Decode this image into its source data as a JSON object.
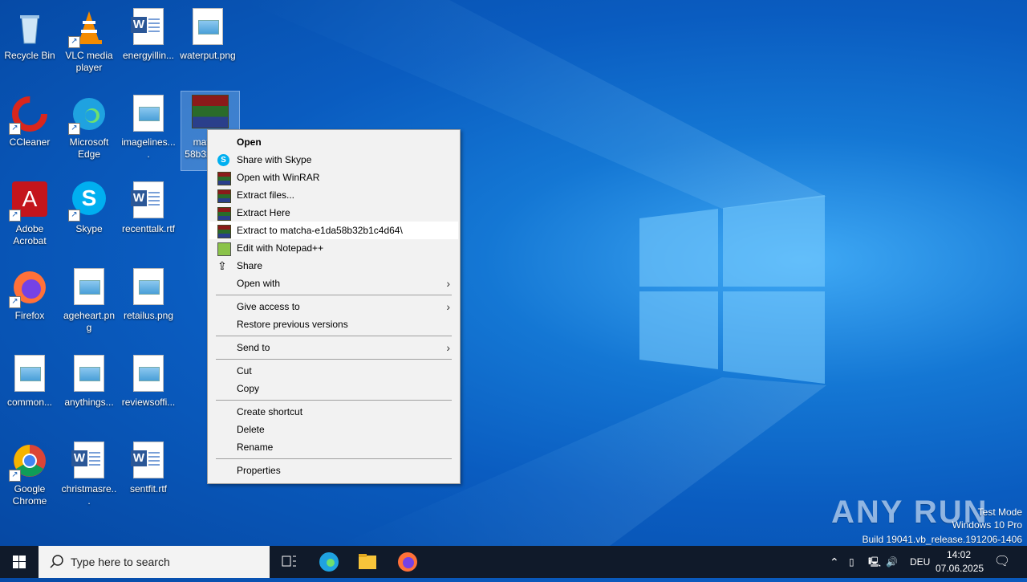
{
  "desktop": {
    "icons": [
      {
        "label": "Recycle Bin"
      },
      {
        "label": "VLC media player"
      },
      {
        "label": "energyillin..."
      },
      {
        "label": "waterput.png"
      },
      {
        "label": "CCleaner"
      },
      {
        "label": "Microsoft Edge"
      },
      {
        "label": "imagelines...."
      },
      {
        "label": "match... 58b32... 4..."
      },
      {
        "label": "Adobe Acrobat"
      },
      {
        "label": "Skype"
      },
      {
        "label": "recenttalk.rtf"
      },
      {
        "label": "Firefox"
      },
      {
        "label": "ageheart.png"
      },
      {
        "label": "retailus.png"
      },
      {
        "label": "common..."
      },
      {
        "label": "anythings..."
      },
      {
        "label": "reviewsoffi..."
      },
      {
        "label": "Google Chrome"
      },
      {
        "label": "christmasre..."
      },
      {
        "label": "sentfit.rtf"
      }
    ]
  },
  "context_menu": {
    "items": [
      {
        "label": "Open"
      },
      {
        "label": "Share with Skype"
      },
      {
        "label": "Open with WinRAR"
      },
      {
        "label": "Extract files..."
      },
      {
        "label": "Extract Here"
      },
      {
        "label": "Extract to matcha-e1da58b32b1c4d64\\"
      },
      {
        "label": "Edit with Notepad++"
      },
      {
        "label": "Share"
      },
      {
        "label": "Open with"
      },
      {
        "label": "Give access to"
      },
      {
        "label": "Restore previous versions"
      },
      {
        "label": "Send to"
      },
      {
        "label": "Cut"
      },
      {
        "label": "Copy"
      },
      {
        "label": "Create shortcut"
      },
      {
        "label": "Delete"
      },
      {
        "label": "Rename"
      },
      {
        "label": "Properties"
      }
    ]
  },
  "taskbar": {
    "search_placeholder": "Type here to search",
    "language": "DEU",
    "time": "14:02",
    "date": "07.06.2025"
  },
  "watermark": {
    "brand": "ANY RUN",
    "line1": "Test Mode",
    "line2": "Windows 10 Pro",
    "line3": "Build 19041.vb_release.191206-1406"
  },
  "colors": {
    "desktop": "#0a5cc0",
    "taskbar": "#101a2a",
    "menu_bg": "#f2f2f2",
    "menu_hover": "#ffffff"
  }
}
